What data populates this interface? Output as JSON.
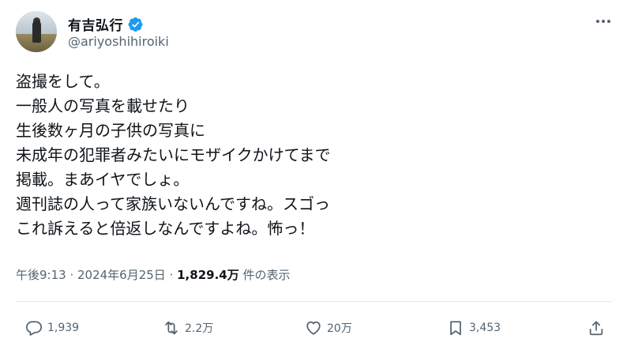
{
  "author": {
    "name": "有吉弘行",
    "handle": "@ariyoshihiroiki",
    "verified": true
  },
  "tweet": {
    "lines": [
      "盗撮をして。",
      "一般人の写真を載せたり",
      "生後数ヶ月の子供の写真に",
      "未成年の犯罪者みたいにモザイクかけてまで",
      "掲載。まあイヤでしょ。",
      "週刊誌の人って家族いないんですね。スゴっ",
      "これ訴えると倍返しなんですよね。怖っ！"
    ]
  },
  "meta": {
    "time": "午後9:13",
    "separator": " · ",
    "date": "2024年6月25日",
    "views": "1,829.4万",
    "views_suffix": " 件の表示"
  },
  "actions": {
    "replies": "1,939",
    "reposts": "2.2万",
    "likes": "20万",
    "bookmarks": "3,453"
  },
  "icons": {
    "verified": "verified-badge-icon",
    "more": "more-icon",
    "reply": "reply-icon",
    "repost": "repost-icon",
    "like": "heart-icon",
    "bookmark": "bookmark-icon",
    "share": "share-icon"
  },
  "colors": {
    "verified": "#1d9bf0",
    "text": "#0f1419",
    "secondary": "#536471"
  }
}
